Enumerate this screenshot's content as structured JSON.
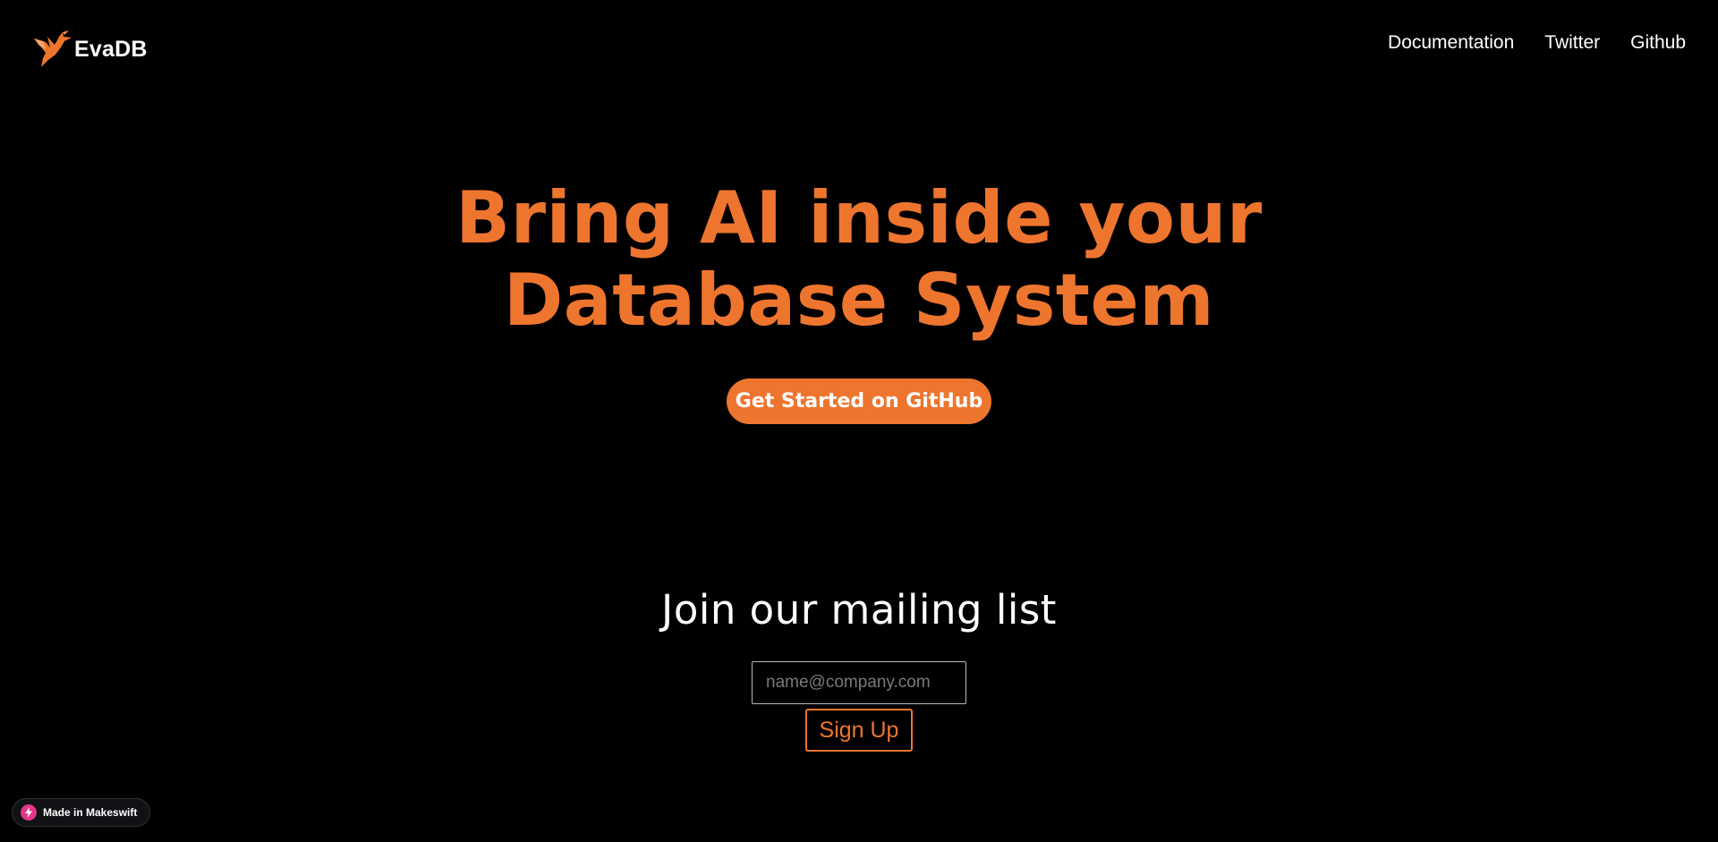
{
  "header": {
    "logo_text": "EvaDB",
    "logo_icon": "hummingbird-logo-icon",
    "nav": [
      {
        "label": "Documentation"
      },
      {
        "label": "Twitter"
      },
      {
        "label": "Github"
      }
    ]
  },
  "hero": {
    "title_line1": "Bring AI inside your",
    "title_line2": "Database System",
    "cta_label": "Get Started on GitHub"
  },
  "mailing": {
    "title": "Join our mailing list",
    "email_placeholder": "name@company.com",
    "email_value": "",
    "signup_label": "Sign Up"
  },
  "badge": {
    "icon": "makeswift-bolt-icon",
    "label": "Made in Makeswift"
  },
  "colors": {
    "background": "#000000",
    "accent": "#ee752e",
    "text": "#ffffff",
    "badge_icon": "#e3358a"
  }
}
